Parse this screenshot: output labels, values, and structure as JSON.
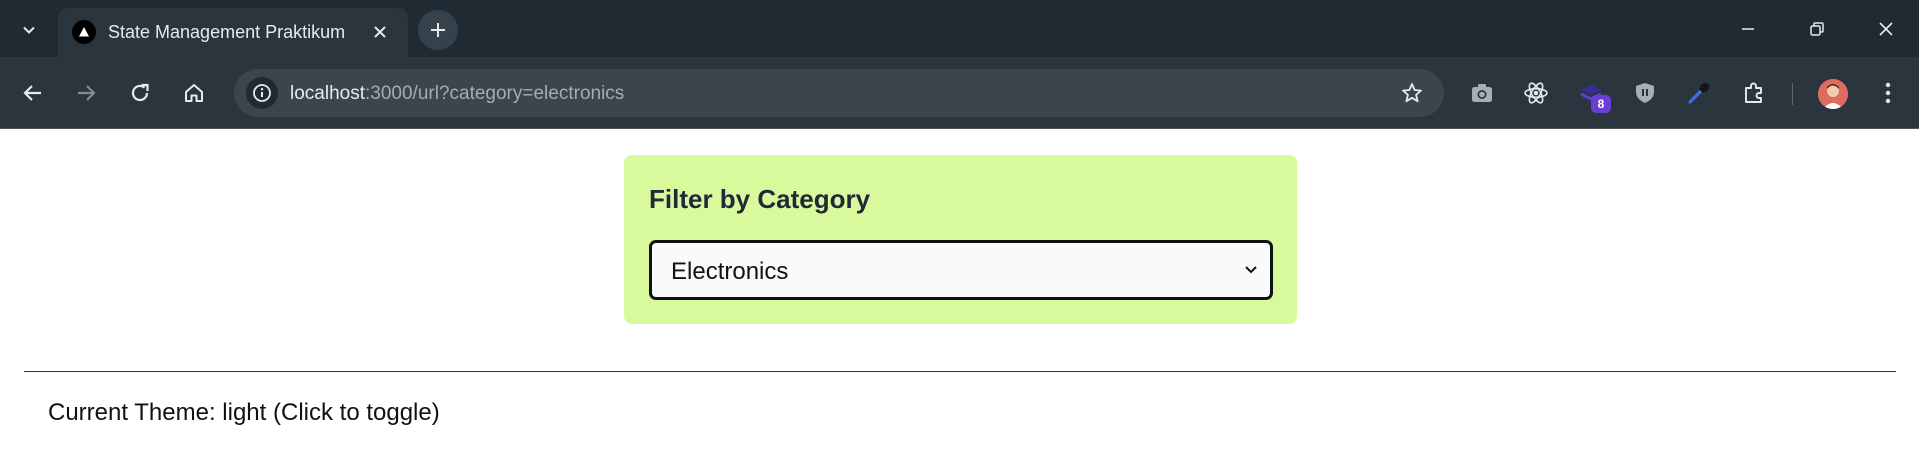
{
  "browser": {
    "tab": {
      "title": "State Management Praktikum",
      "favicon": "triangle-logo-icon"
    },
    "address_bar": {
      "host": "localhost",
      "path": ":3000/url?category=electronics"
    },
    "extensions": {
      "badge_count": "8"
    },
    "colors": {
      "frame": "#202a33",
      "toolbar": "#2a353e",
      "omnibox": "#3a454e",
      "badge": "#6a3fd6"
    }
  },
  "page": {
    "filter": {
      "heading": "Filter by Category",
      "selected_option": "Electronics"
    },
    "theme_toggle": {
      "label": "Current Theme: light (Click to toggle)"
    },
    "colors": {
      "card_background": "#d9f99d",
      "select_background": "#f8fafc",
      "text": "#1f2937"
    }
  }
}
